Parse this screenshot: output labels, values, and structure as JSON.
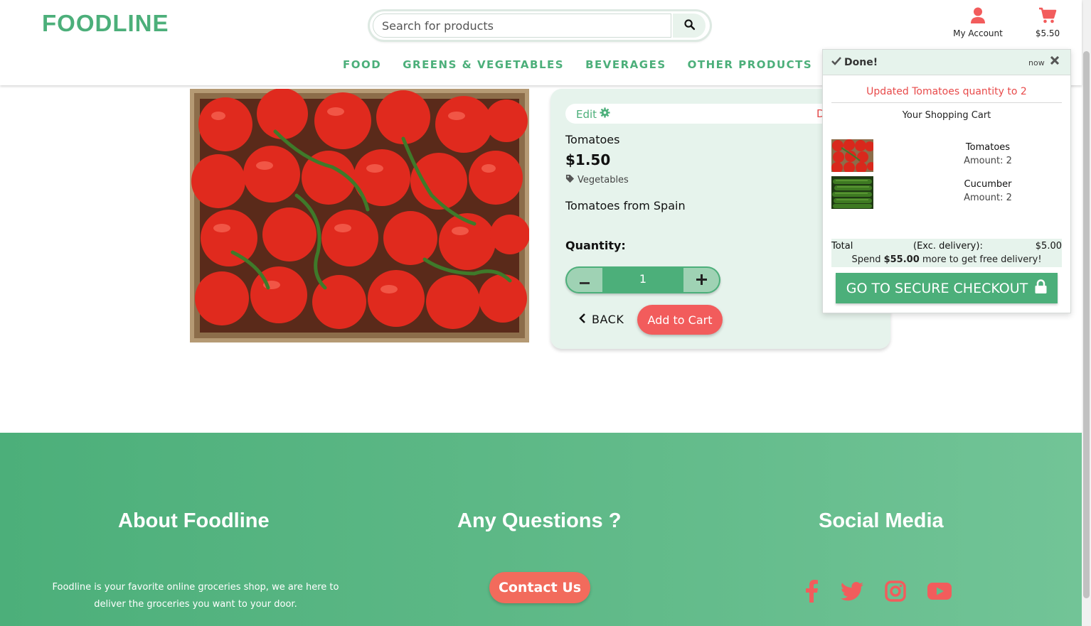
{
  "brand": {
    "logo": "FOODLINE"
  },
  "search": {
    "placeholder": "Search for products"
  },
  "header": {
    "account_label": "My Account",
    "cart_total": "$5.50"
  },
  "nav": {
    "items": [
      "FOOD",
      "GREENS & VEGETABLES",
      "BEVERAGES",
      "OTHER PRODUCTS"
    ]
  },
  "product": {
    "edit_label": "Edit",
    "delete_label": "D",
    "name": "Tomatoes",
    "price": "$1.50",
    "category": "Vegetables",
    "description": "Tomatoes from Spain",
    "quantity_label": "Quantity:",
    "quantity_value": "1",
    "back_label": "BACK",
    "add_to_cart_label": "Add to Cart"
  },
  "toast": {
    "title": "Done!",
    "time": "now",
    "message": "Updated Tomatoes quantity to 2",
    "subtitle": "Your Shopping Cart",
    "items": [
      {
        "name": "Tomatoes",
        "amount": "Amount: 2"
      },
      {
        "name": "Cucumber",
        "amount": "Amount: 2"
      }
    ],
    "total_label": "Total",
    "total_exc": "(Exc. delivery):",
    "total_value": "$5.00",
    "spend_prefix": "Spend ",
    "spend_amount": "$55.00",
    "spend_suffix": " more to get free delivery!",
    "checkout_label": "GO TO SECURE CHECKOUT"
  },
  "footer": {
    "about_title": "About Foodline",
    "about_text": "Foodline is your favorite online groceries shop, we are here to deliver the groceries you want to your door.",
    "questions_title": "Any Questions ?",
    "contact_label": "Contact Us",
    "social_title": "Social Media",
    "social_icons": [
      "facebook-icon",
      "twitter-icon",
      "instagram-icon",
      "youtube-icon"
    ]
  },
  "colors": {
    "brand_green": "#4caf7a",
    "accent_red": "#f25c5c",
    "panel_green": "#e6f3ec"
  }
}
